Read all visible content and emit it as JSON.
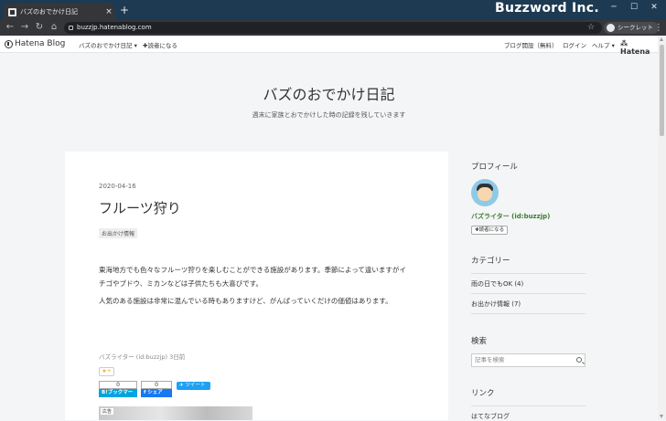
{
  "browser": {
    "tab_title": "バズのおでかけ日記",
    "close_glyph": "×",
    "newtab_glyph": "+",
    "brand": "Buzzword Inc.",
    "url": "buzzjp.hatenablog.com",
    "incognito_label": "シークレット"
  },
  "hatena_bar": {
    "logo": "Hatena Blog",
    "blog_menu": "バズのおでかけ日記",
    "subscribe": "✚読者になる",
    "start_blog": "ブログ開設（無料）",
    "login": "ログイン",
    "help": "ヘルプ",
    "hatena": "Hatena"
  },
  "blog": {
    "title": "バズのおでかけ日記",
    "description": "週末に家族とおでかけした時の記録を残していきます"
  },
  "entry": {
    "date": "2020-04-16",
    "title": "フルーツ狩り",
    "category": "お出かけ情報",
    "paragraph1": "東海地方でも色々なフルーツ狩りを楽しむことができる施設があります。季節によって違いますがイチゴやブドウ、ミカンなどは子供たちも大喜びです。",
    "paragraph2": "人気のある施設は非常に混んでいる時もありますけど、がんばっていくだけの価値はあります。",
    "author_line": "バズライター (id:buzzjp) 3日前",
    "star_button": "★+",
    "bookmark_count": "0",
    "bookmark_label": "B!ブックマーク",
    "facebook_count": "0",
    "facebook_label": "f シェア",
    "tweet_label": "ツイート",
    "image_tag": "広告"
  },
  "sidebar": {
    "profile_heading": "プロフィール",
    "username": "バズライター (id:buzzjp)",
    "subscribe_button": "✚読者になる",
    "category_heading": "カテゴリー",
    "categories": [
      "雨の日でもOK (4)",
      "お出かけ情報 (7)"
    ],
    "search_heading": "検索",
    "search_placeholder": "記事を検索",
    "links_heading": "リンク",
    "links": [
      "はてなブログ"
    ]
  },
  "colors": {
    "titlebar": "#1e3a52",
    "toolbar": "#35363a",
    "username_green": "#3a7c2f",
    "bookmark_blue": "#00a4de",
    "facebook_blue": "#1877f2",
    "twitter_blue": "#1da1f2"
  }
}
